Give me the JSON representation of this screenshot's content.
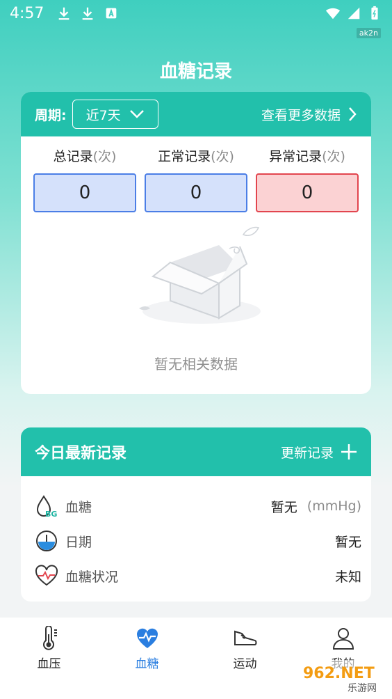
{
  "status_bar": {
    "time": "4:57",
    "tag": "ak2n"
  },
  "app": {
    "title": "血糖记录"
  },
  "summary_card": {
    "period_label": "周期:",
    "period_value": "近7天",
    "more_link": "查看更多数据",
    "stats": [
      {
        "label": "总记录",
        "unit": "(次)",
        "value": "0"
      },
      {
        "label": "正常记录",
        "unit": "(次)",
        "value": "0"
      },
      {
        "label": "异常记录",
        "unit": "(次)",
        "value": "0"
      }
    ],
    "empty_text": "暂无相关数据"
  },
  "today_card": {
    "title": "今日最新记录",
    "update_link": "更新记录",
    "rows": [
      {
        "label": "血糖",
        "value": "暂无",
        "unit": "(mmHg)",
        "icon": "blood-glucose-icon"
      },
      {
        "label": "日期",
        "value": "暂无",
        "icon": "clock-icon"
      },
      {
        "label": "血糖状况",
        "value": "未知",
        "icon": "heart-rate-icon"
      }
    ]
  },
  "tabbar": {
    "tabs": [
      {
        "label": "血压",
        "icon": "thermometer-icon"
      },
      {
        "label": "血糖",
        "icon": "heartbeat-icon",
        "active": true
      },
      {
        "label": "运动",
        "icon": "shoe-icon"
      },
      {
        "label": "我的",
        "icon": "user-icon"
      }
    ]
  },
  "watermark": {
    "brand": "962.NET",
    "subtitle": "乐游网"
  },
  "colors": {
    "accent": "#22c0ab",
    "tab_active": "#2a7ee0",
    "normal_box": "#d5e1fb",
    "abnormal_box": "#fbd2d3"
  }
}
